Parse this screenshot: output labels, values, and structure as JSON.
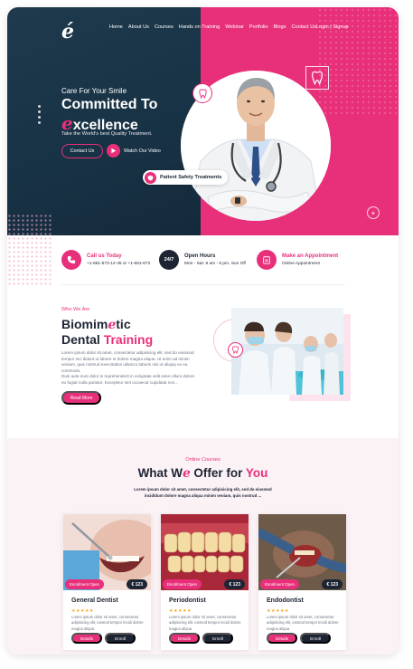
{
  "brand": {
    "logo": "é",
    "accent": "#e8307a",
    "dark": "#1d2433",
    "navy": "#1e3a4c"
  },
  "nav": {
    "items": [
      "Home",
      "About Us",
      "Courses",
      "Hands on Training",
      "Webinar",
      "Portfolio",
      "Blogs",
      "Contact Us"
    ],
    "login": "Login | Signup"
  },
  "hero": {
    "tagline": "Care For Your Smile",
    "headline_line1": "Committed To",
    "headline_e": "e",
    "headline_rest": "xcellence",
    "subtitle": "Take the World's best Quality Treatment.",
    "contact_button": "Contact Us",
    "watch_label": "Watch Our Video",
    "safety_badge": "Patient Safety Treatments"
  },
  "info": {
    "call": {
      "title": "Call us Today",
      "value": "+1-651-673-12-45 or +1-651-673",
      "icon": "phone-icon"
    },
    "hours": {
      "title": "Open Hours",
      "value": "Mon - Sat: 8 am - 5 pm, Sun Off",
      "icon": "clock-247-icon",
      "badge": "24/7"
    },
    "appointment": {
      "title": "Make an Appointment",
      "value": "Online Appointment",
      "icon": "calendar-icon"
    }
  },
  "who": {
    "label": "Who We Are",
    "title_pre": "Biomim",
    "title_e": "e",
    "title_post": "tic",
    "title2_pre": "Dental ",
    "title2_pink": "Training",
    "p1": "Lorem ipsum dolor sit amet, consectetur adipisicing elit, sed do eiusmod tempor inci didunt ut labore et dolore magna aliqua. Ut enim ad minim veniam, quis nostrud exercitation ullamco laboris nisi ut aliquip ex ea commodo.",
    "p2": "Duis aute irure dolor in reprehenderit in voluptate velit esse cillum dolore eu fugiat nulla pariatur. Excepteur sint occaecat cupidatat non...",
    "read_more": "Read More"
  },
  "courses": {
    "label": "Online Courses",
    "title_pre": "What W",
    "title_e": "e",
    "title_mid": " Offer for ",
    "title_pink": "You",
    "subtitle": "Lorem ipsum dolor sit amet, consectetur adipisicing elit, sed do eiusmod incididunt dolore magna aliqua minim veniam, quis nostrud ...",
    "cards": [
      {
        "name": "General Dentist",
        "enroll": "Enrollment Open",
        "price": "€ 123",
        "stars": "★★★★★",
        "desc": "Lorem ipsum dolor sit amet, consectetur adipisicing elit, iusmod tempor incidi dolore magna aliqua",
        "details": "Details",
        "enroll_btn": "Enroll"
      },
      {
        "name": "Periodontist",
        "enroll": "Enrollment Open",
        "price": "€ 123",
        "stars": "★★★★★",
        "desc": "Lorem ipsum dolor sit amet, consectetur adipisicing elit, iusmod tempor incidi dolore magna aliqua",
        "details": "Details",
        "enroll_btn": "Enroll"
      },
      {
        "name": "Endodontist",
        "enroll": "Enrollment Open",
        "price": "€ 123",
        "stars": "★★★★★",
        "desc": "Lorem ipsum dolor sit amet, consectetur adipisicing elit, iusmod tempor incidi dolore magna aliqua",
        "details": "Details",
        "enroll_btn": "Enroll"
      }
    ]
  }
}
